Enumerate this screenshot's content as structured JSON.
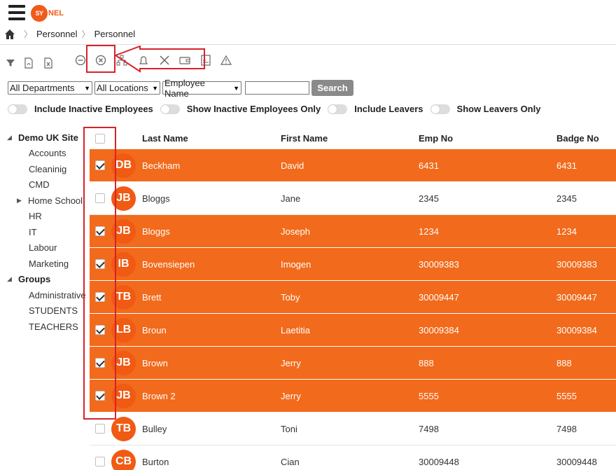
{
  "header": {
    "logo_mark": "SY",
    "logo_rest": "NEL"
  },
  "breadcrumb": [
    "Personnel",
    "Personnel"
  ],
  "toolbar_icons": [
    "filter-icon",
    "pdf-icon",
    "excel-icon",
    "minus-circle-icon",
    "x-circle-icon",
    "org-chart-icon",
    "bell-icon",
    "tools-icon",
    "wallet-icon",
    "id-card-icon",
    "alert-icon"
  ],
  "filters": {
    "department": "All Departments",
    "location": "All Locations",
    "sort": "Employee Name",
    "search_value": "",
    "search_label": "Search"
  },
  "toggles": [
    "Include Inactive Employees",
    "Show Inactive Employees Only",
    "Include Leavers",
    "Show Leavers Only"
  ],
  "tree": {
    "site": "Demo UK Site",
    "departments": [
      "Accounts",
      "Cleaninig",
      "CMD",
      "Home School",
      "HR",
      "IT",
      "Labour",
      "Marketing"
    ],
    "groups_label": "Groups",
    "groups": [
      "Administrative",
      "STUDENTS",
      "TEACHERS"
    ]
  },
  "grid": {
    "columns": [
      "Last Name",
      "First Name",
      "Emp No",
      "Badge No"
    ],
    "rows": [
      {
        "initials": "DB",
        "last": "Beckham",
        "first": "David",
        "emp": "6431",
        "badge": "6431",
        "checked": true
      },
      {
        "initials": "JB",
        "last": "Bloggs",
        "first": "Jane",
        "emp": "2345",
        "badge": "2345",
        "checked": false
      },
      {
        "initials": "JB",
        "last": "Bloggs",
        "first": "Joseph",
        "emp": "1234",
        "badge": "1234",
        "checked": true
      },
      {
        "initials": "IB",
        "last": "Bovensiepen",
        "first": "Imogen",
        "emp": "30009383",
        "badge": "30009383",
        "checked": true
      },
      {
        "initials": "TB",
        "last": "Brett",
        "first": "Toby",
        "emp": "30009447",
        "badge": "30009447",
        "checked": true
      },
      {
        "initials": "LB",
        "last": "Broun",
        "first": "Laetitia",
        "emp": "30009384",
        "badge": "30009384",
        "checked": true
      },
      {
        "initials": "JB",
        "last": "Brown",
        "first": "Jerry",
        "emp": "888",
        "badge": "888",
        "checked": true
      },
      {
        "initials": "JB",
        "last": "Brown 2",
        "first": "Jerry",
        "emp": "5555",
        "badge": "5555",
        "checked": true
      },
      {
        "initials": "TB",
        "last": "Bulley",
        "first": "Toni",
        "emp": "7498",
        "badge": "7498",
        "checked": false
      },
      {
        "initials": "CB",
        "last": "Burton",
        "first": "Cian",
        "emp": "30009448",
        "badge": "30009448",
        "checked": false
      }
    ]
  },
  "colors": {
    "accent": "#f26a1b",
    "annotation": "#d6232a"
  }
}
